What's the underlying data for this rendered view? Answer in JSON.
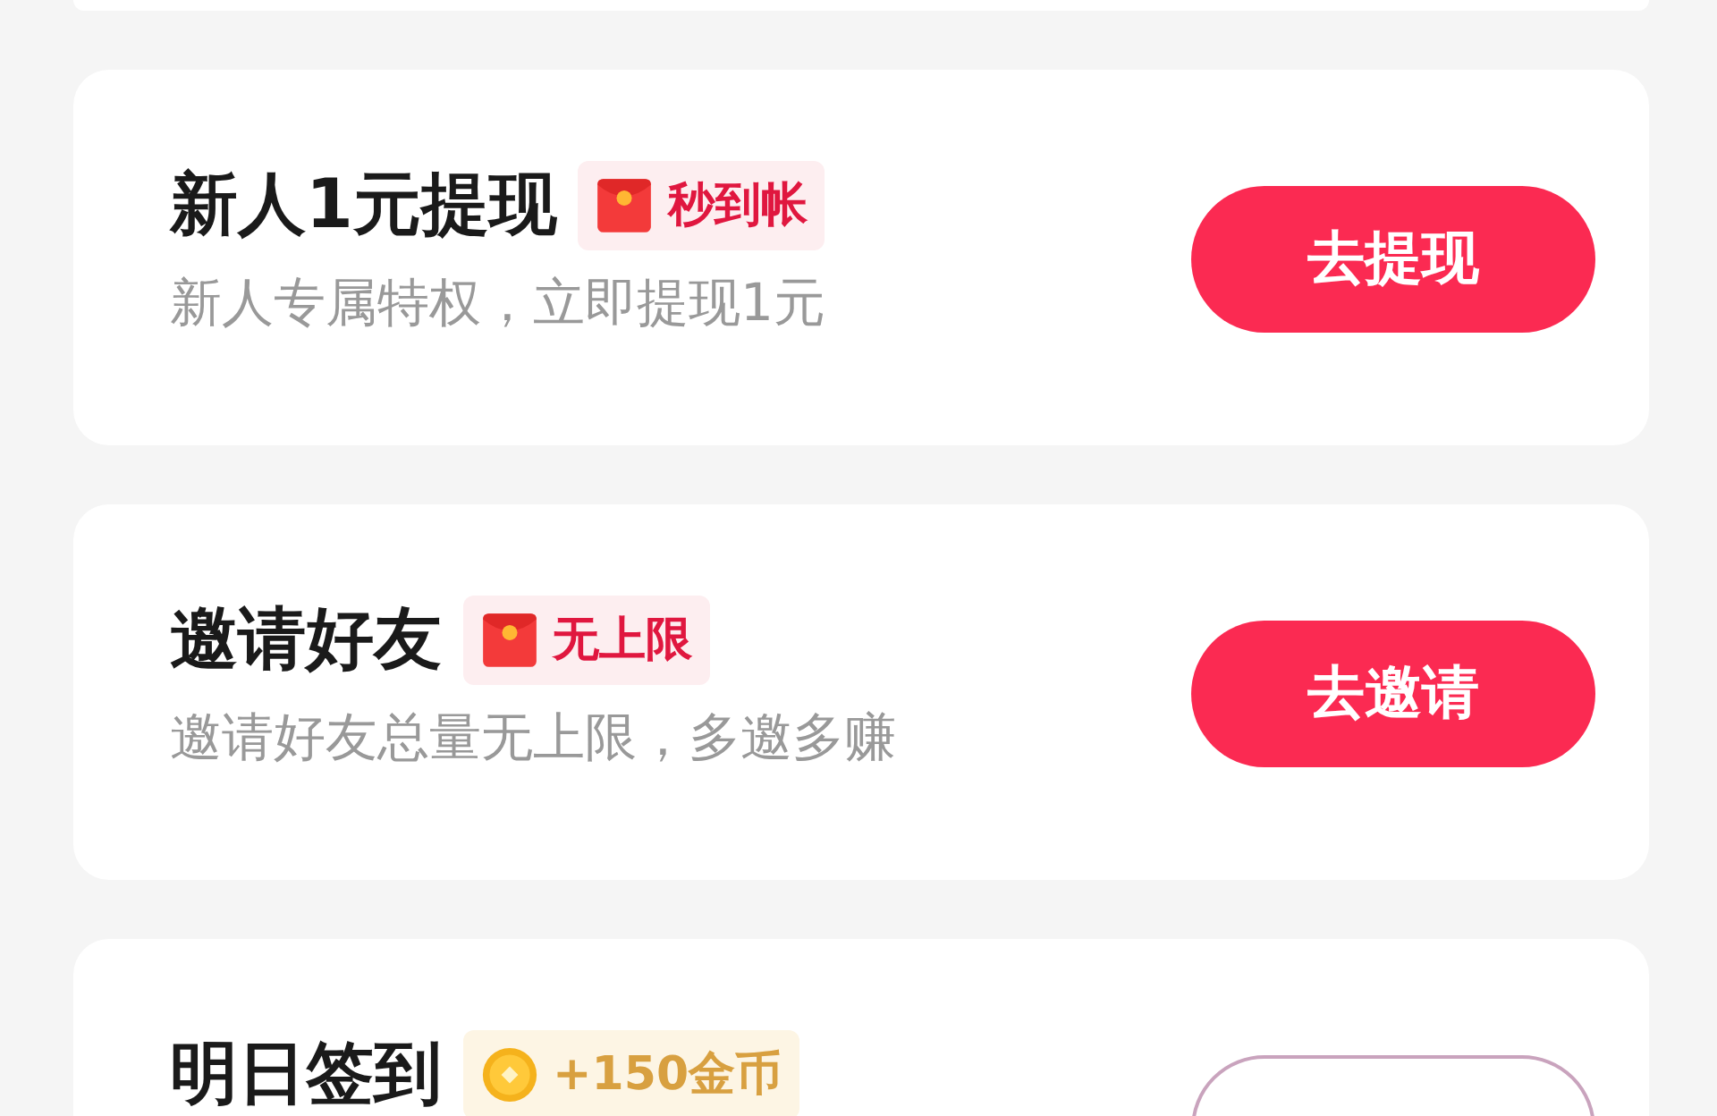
{
  "tasks": [
    {
      "title": "新人1元提现",
      "badge": {
        "kind": "redpacket",
        "text": "秒到帐"
      },
      "subtitle": "新人专属特权，立即提现1元",
      "button": {
        "kind": "filled",
        "label": "去提现"
      }
    },
    {
      "title": "邀请好友",
      "badge": {
        "kind": "redpacket",
        "text": "无上限"
      },
      "subtitle": "邀请好友总量无上限，多邀多赚",
      "button": {
        "kind": "filled",
        "label": "去邀请"
      }
    },
    {
      "title": "明日签到",
      "badge": {
        "kind": "coin",
        "text": "+150金币"
      },
      "button": {
        "kind": "outline"
      }
    }
  ]
}
